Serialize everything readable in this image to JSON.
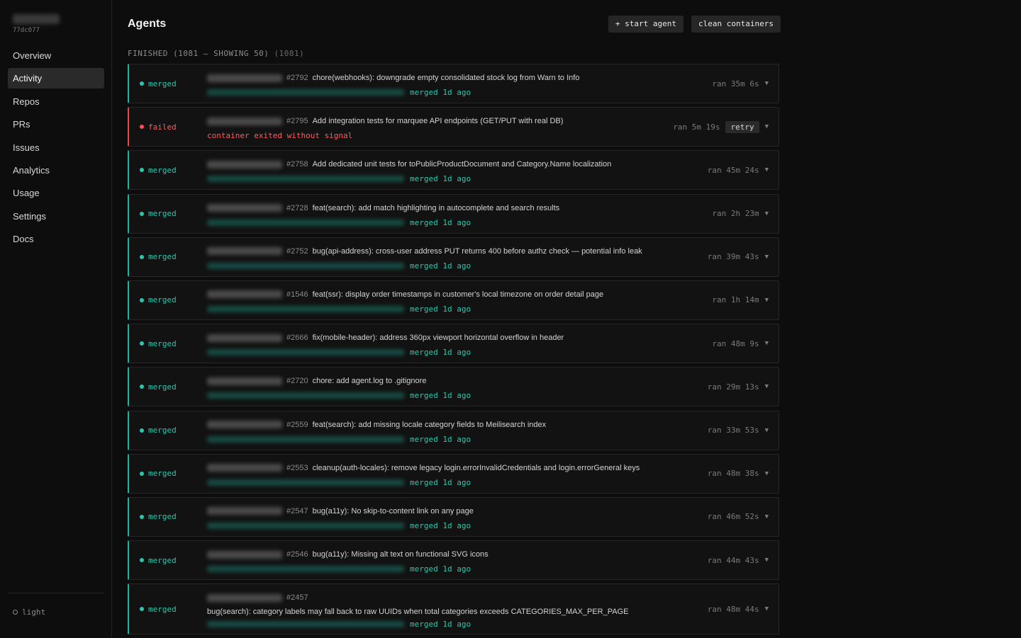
{
  "sidebar": {
    "hash": "77dc077",
    "items": [
      {
        "label": "Overview",
        "active": false
      },
      {
        "label": "Activity",
        "active": true
      },
      {
        "label": "Repos",
        "active": false
      },
      {
        "label": "PRs",
        "active": false
      },
      {
        "label": "Issues",
        "active": false
      },
      {
        "label": "Analytics",
        "active": false
      },
      {
        "label": "Usage",
        "active": false
      },
      {
        "label": "Settings",
        "active": false
      },
      {
        "label": "Docs",
        "active": false
      }
    ],
    "theme_label": "light"
  },
  "header": {
    "title": "Agents",
    "start_label": "+ start agent",
    "clean_label": "clean containers"
  },
  "section": {
    "heading": "FINISHED (1081 — SHOWING 50)",
    "count": "(1081)"
  },
  "colors": {
    "merged": "#29c7ae",
    "failed": "#ff5a5f",
    "background": "#0d0d0d"
  },
  "icons": {
    "status": "dot-icon",
    "expand": "chevron-down-icon",
    "theme": "circle-icon"
  },
  "rows": [
    {
      "status": "merged",
      "pr": "#2792",
      "title": "chore(webhooks): downgrade empty consolidated stock log from Warn to Info",
      "merged_text": "merged 1d ago",
      "ran": "ran 35m 6s"
    },
    {
      "status": "failed",
      "pr": "#2795",
      "title": "Add integration tests for marquee API endpoints (GET/PUT with real DB)",
      "error": "container exited without signal",
      "ran": "ran 5m 19s",
      "retry_label": "retry"
    },
    {
      "status": "merged",
      "pr": "#2758",
      "title": "Add dedicated unit tests for toPublicProductDocument and Category.Name localization",
      "merged_text": "merged 1d ago",
      "ran": "ran 45m 24s"
    },
    {
      "status": "merged",
      "pr": "#2728",
      "title": "feat(search): add match highlighting in autocomplete and search results",
      "merged_text": "merged 1d ago",
      "ran": "ran 2h 23m"
    },
    {
      "status": "merged",
      "pr": "#2752",
      "title": "bug(api-address): cross-user address PUT returns 400 before authz check — potential info leak",
      "merged_text": "merged 1d ago",
      "ran": "ran 39m 43s"
    },
    {
      "status": "merged",
      "pr": "#1546",
      "title": "feat(ssr): display order timestamps in customer's local timezone on order detail page",
      "merged_text": "merged 1d ago",
      "ran": "ran 1h 14m"
    },
    {
      "status": "merged",
      "pr": "#2666",
      "title": "fix(mobile-header): address 360px viewport horizontal overflow in header",
      "merged_text": "merged 1d ago",
      "ran": "ran 48m 9s"
    },
    {
      "status": "merged",
      "pr": "#2720",
      "title": "chore: add agent.log to .gitignore",
      "merged_text": "merged 1d ago",
      "ran": "ran 29m 13s"
    },
    {
      "status": "merged",
      "pr": "#2559",
      "title": "feat(search): add missing locale category fields to Meilisearch index",
      "merged_text": "merged 1d ago",
      "ran": "ran 33m 53s"
    },
    {
      "status": "merged",
      "pr": "#2553",
      "title": "cleanup(auth-locales): remove legacy login.errorInvalidCredentials and login.errorGeneral keys",
      "merged_text": "merged 1d ago",
      "ran": "ran 48m 38s"
    },
    {
      "status": "merged",
      "pr": "#2547",
      "title": "bug(a11y): No skip-to-content link on any page",
      "merged_text": "merged 1d ago",
      "ran": "ran 46m 52s"
    },
    {
      "status": "merged",
      "pr": "#2546",
      "title": "bug(a11y): Missing alt text on functional SVG icons",
      "merged_text": "merged 1d ago",
      "ran": "ran 44m 43s"
    },
    {
      "status": "merged",
      "pr": "#2457",
      "title": "bug(search): category labels may fall back to raw UUIDs when total categories exceeds CATEGORIES_MAX_PER_PAGE",
      "merged_text": "merged 1d ago",
      "ran": "ran 48m 44s",
      "wrapped": true
    }
  ]
}
